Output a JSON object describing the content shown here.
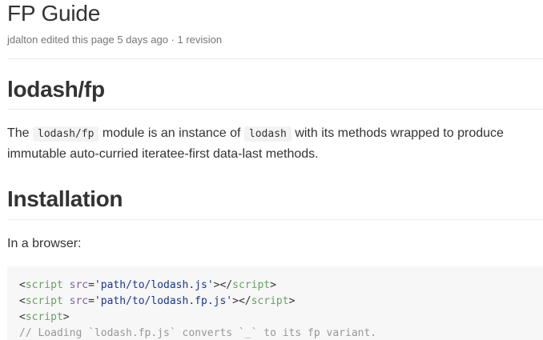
{
  "page": {
    "title": "FP Guide",
    "meta": "jdalton edited this page 5 days ago · 1 revision"
  },
  "sections": {
    "lodash_fp": {
      "heading": "lodash/fp",
      "intro_pre": "The ",
      "code_module": "lodash/fp",
      "intro_mid": " module is an instance of ",
      "code_lodash": "lodash",
      "intro_post": " with its methods wrapped to produce immutable auto-curried iteratee-first data-last methods."
    },
    "installation": {
      "heading": "Installation",
      "browser_label": "In a browser:"
    }
  },
  "code_block": {
    "line1": {
      "open_lt": "<",
      "tag": "script",
      "sp": " ",
      "attr": "src",
      "eq": "=",
      "value": "'path/to/lodash.js'",
      "gt_close_lt": "></",
      "close_tag": "script",
      "gt": ">"
    },
    "line2": {
      "open_lt": "<",
      "tag": "script",
      "sp": " ",
      "attr": "src",
      "eq": "=",
      "value": "'path/to/lodash.fp.js'",
      "gt_close_lt": "></",
      "close_tag": "script",
      "gt": ">"
    },
    "line3": {
      "open_lt": "<",
      "tag": "script",
      "gt": ">"
    },
    "line4": {
      "comment": "// Loading `lodash.fp.js` converts `_` to its fp variant."
    }
  },
  "colors": {
    "tag": "#63a35c",
    "attr": "#795da3",
    "string": "#183691",
    "comment": "#969896",
    "code_bg": "#f7f7f7"
  }
}
